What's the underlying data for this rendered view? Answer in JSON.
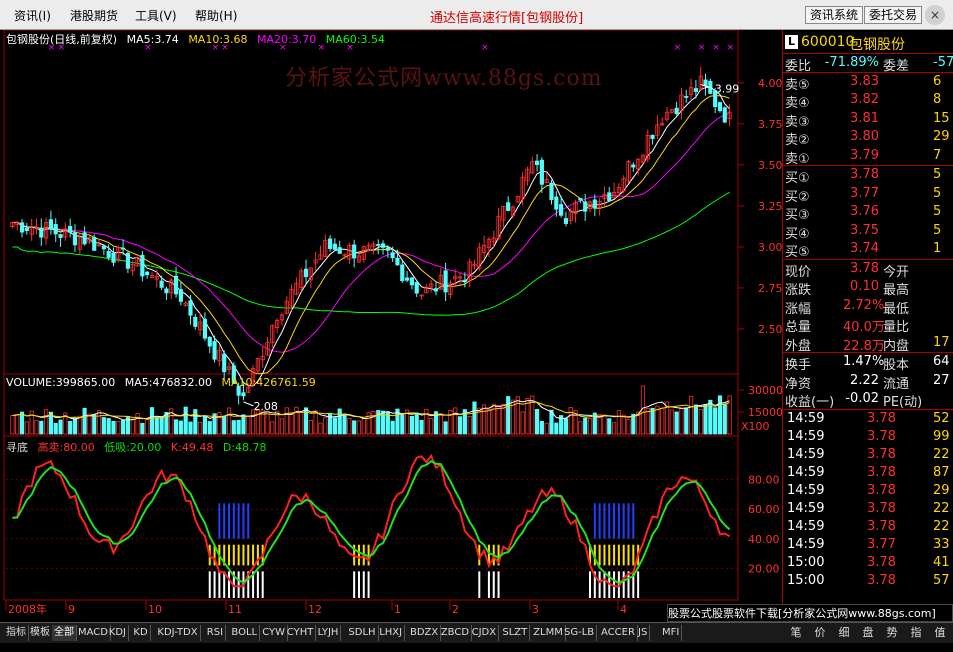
{
  "menu": {
    "items": [
      "资讯(I)",
      "港股期货",
      "工具(V)",
      "帮助(H)"
    ],
    "title": "通达信高速行情[包钢股份]",
    "buttons": [
      "资讯系统",
      "委托交易"
    ],
    "close_label": "×"
  },
  "main_panel": {
    "header": {
      "name": "包钢股份(日线,前复权)",
      "ma5": "MA5:3.74",
      "ma10": "MA10:3.68",
      "ma20": "MA20:3.70",
      "ma60": "MA60:3.54"
    },
    "watermark": "分析家公式网www.88gs.com",
    "high_label": "3.99",
    "low_label": "2.08",
    "y_ticks": [
      "4.00",
      "3.75",
      "3.50",
      "3.25",
      "3.00",
      "2.75",
      "2.50"
    ]
  },
  "volume_panel": {
    "header": {
      "vol": "VOLUME:399865.00",
      "ma5": "MA5:476832.00",
      "ma10": "MA10:426761.59"
    },
    "y_ticks": [
      "30000",
      "15000"
    ],
    "unit": "X100"
  },
  "indicator_panel": {
    "header": {
      "name": "寻底",
      "high": "高卖:80.00",
      "low": "低吸:20.00",
      "k": "K:49.48",
      "d": "D:48.78"
    },
    "y_ticks": [
      "80.00",
      "60.00",
      "40.00",
      "20.00"
    ]
  },
  "date_axis": [
    "2008年",
    "9",
    "10",
    "11",
    "12",
    "1",
    "2",
    "3",
    "4"
  ],
  "quote": {
    "code": "600010",
    "name": "包钢股份",
    "badge": "L",
    "webi": {
      "label": "委比",
      "value": "-71.89%",
      "label2": "委差",
      "value2": "-57"
    },
    "asks": [
      {
        "label": "卖⑤",
        "price": "3.83",
        "vol": "6"
      },
      {
        "label": "卖④",
        "price": "3.82",
        "vol": "8"
      },
      {
        "label": "卖③",
        "price": "3.81",
        "vol": "15"
      },
      {
        "label": "卖②",
        "price": "3.80",
        "vol": "29"
      },
      {
        "label": "卖①",
        "price": "3.79",
        "vol": "7"
      }
    ],
    "bids": [
      {
        "label": "买①",
        "price": "3.78",
        "vol": "5"
      },
      {
        "label": "买②",
        "price": "3.77",
        "vol": "5"
      },
      {
        "label": "买③",
        "price": "3.76",
        "vol": "5"
      },
      {
        "label": "买④",
        "price": "3.75",
        "vol": "5"
      },
      {
        "label": "买⑤",
        "price": "3.74",
        "vol": "1"
      }
    ],
    "stats": [
      {
        "label": "现价",
        "value": "3.78",
        "label2": "今开",
        "value2": ""
      },
      {
        "label": "涨跌",
        "value": "0.10",
        "label2": "最高",
        "value2": ""
      },
      {
        "label": "涨幅",
        "value": "2.72%",
        "label2": "最低",
        "value2": ""
      },
      {
        "label": "总量",
        "value": "40.0万",
        "label2": "量比",
        "value2": ""
      },
      {
        "label": "外盘",
        "value": "22.8万",
        "label2": "内盘",
        "value2": "17"
      }
    ],
    "stats2": [
      {
        "label": "换手",
        "value": "1.47%",
        "label2": "股本",
        "value2": "64"
      },
      {
        "label": "净资",
        "value": "2.22",
        "label2": "流通",
        "value2": "27"
      },
      {
        "label": "收益(一)",
        "value": "-0.02",
        "label2": "PE(动)",
        "value2": ""
      }
    ],
    "ticks": [
      {
        "time": "14:59",
        "price": "3.78",
        "vol": "52"
      },
      {
        "time": "14:59",
        "price": "3.78",
        "vol": "99"
      },
      {
        "time": "14:59",
        "price": "3.78",
        "vol": "22"
      },
      {
        "time": "14:59",
        "price": "3.78",
        "vol": "87"
      },
      {
        "time": "14:59",
        "price": "3.78",
        "vol": "29"
      },
      {
        "time": "14:59",
        "price": "3.78",
        "vol": "22"
      },
      {
        "time": "14:59",
        "price": "3.78",
        "vol": "22"
      },
      {
        "time": "14:59",
        "price": "3.77",
        "vol": "33"
      },
      {
        "time": "15:00",
        "price": "3.78",
        "vol": "41"
      },
      {
        "time": "15:00",
        "price": "3.78",
        "vol": "57"
      }
    ]
  },
  "ad_text": "股票公式股票软件下载[分析家公式网www.88gs.com]",
  "tabs": [
    "指标",
    "模板",
    "全部",
    "MACD",
    "KDJ",
    "KD",
    "KDJ-TDX",
    "RSI",
    "BOLL",
    "CYW",
    "CYHT",
    "LYJH",
    "SDLH",
    "LHXJ",
    "BDZX",
    "ZBCD",
    "CJDX",
    "SLZT",
    "ZLMM",
    "SG-LB",
    "ACCER",
    "JS",
    "MFI"
  ],
  "right_tabs": [
    "笔",
    "价",
    "细",
    "盘",
    "势",
    "指",
    "值"
  ],
  "colors": {
    "up": "#ff3030",
    "down": "#54fcfc",
    "ma5": "#ffffff",
    "ma10": "#ffd700",
    "ma20": "#ff00ff",
    "ma60": "#00ff00",
    "k_line": "#ff2020",
    "d_line": "#20e020"
  }
}
